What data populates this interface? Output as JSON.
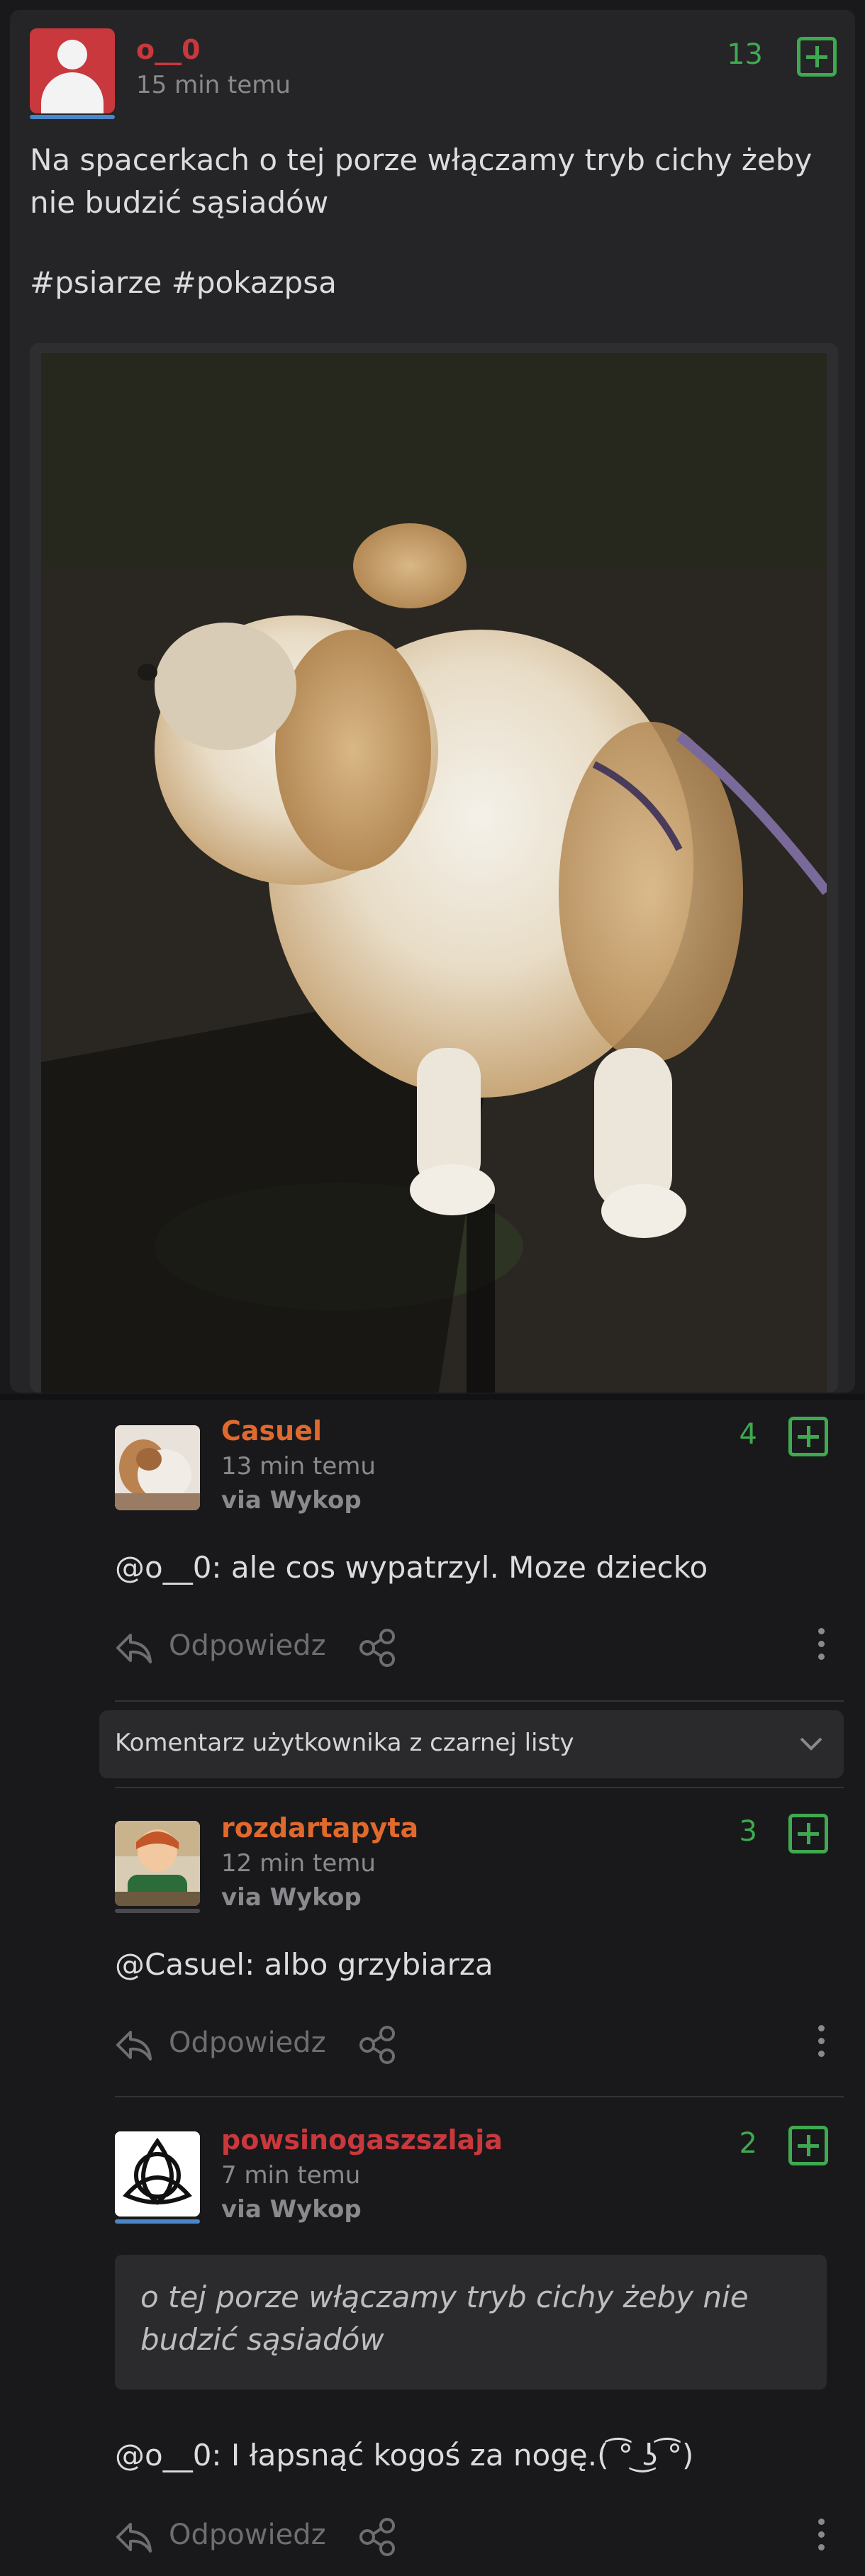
{
  "post": {
    "author": "o__0",
    "time": "15 min temu",
    "votes": "13",
    "text": "Na spacerkach o tej porze włączamy tryb cichy żeby nie budzić sąsiadów",
    "tags": "#psiarze #pokazpsa"
  },
  "comments": [
    {
      "author": "Casuel",
      "author_color": "#e0692e",
      "time": "13 min temu",
      "via": "via Wykop",
      "votes": "4",
      "text": "@o__0: ale cos wypatrzyl. Moze dziecko",
      "reply_label": "Odpowiedz"
    },
    {
      "author": "rozdartapyta",
      "author_color": "#e0692e",
      "time": "12 min temu",
      "via": "via Wykop",
      "votes": "3",
      "text": "@Casuel: albo grzybiarza",
      "reply_label": "Odpowiedz"
    },
    {
      "author": "powsinogaszszlaja",
      "author_color": "#c9383d",
      "time": "7 min temu",
      "via": "via Wykop",
      "votes": "2",
      "quote": "o tej porze włączamy tryb cichy żeby nie budzić sąsiadów",
      "text": "@o__0: I łapsnąć kogoś za nogę.( ͡° ͜ʖ ͡°)",
      "reply_label": "Odpowiedz"
    }
  ],
  "blacklist": {
    "label": "Komentarz użytkownika z czarnej listy"
  },
  "colors": {
    "accent_green": "#3fa950",
    "username_red": "#c9383d",
    "username_orange": "#e0692e",
    "background": "#19191b",
    "card": "#252528"
  },
  "icons": [
    "plus-icon",
    "reply-arrow-icon",
    "share-icon",
    "more-vertical-icon",
    "chevron-down-icon"
  ]
}
